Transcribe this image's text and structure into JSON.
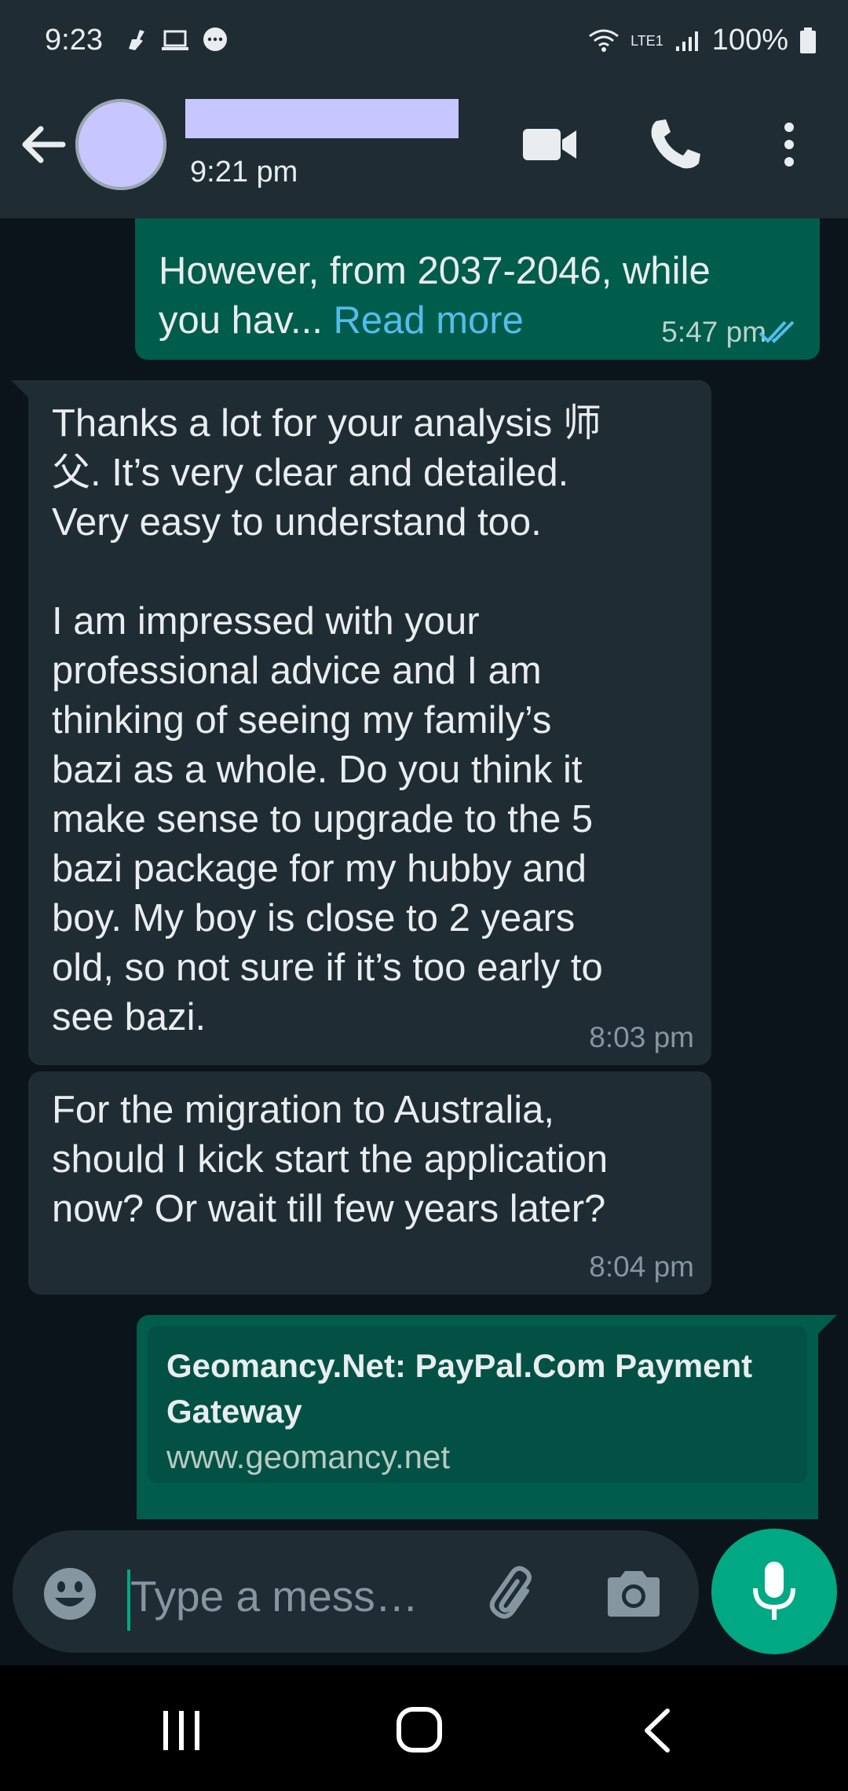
{
  "status_bar": {
    "time": "9:23",
    "battery": "100%",
    "network_label": "LTE1"
  },
  "header": {
    "last_seen": "9:21 pm"
  },
  "messages": [
    {
      "direction": "outgoing",
      "text": "However, from 2037-2046, while\nyou hav... ",
      "read_more": "Read more",
      "time": "5:47 pm",
      "status": "read"
    },
    {
      "direction": "incoming",
      "text": "Thanks a lot for your analysis 师\n父. It’s very clear and detailed.\nVery easy to understand too.\n\nI am impressed with your\nprofessional advice and I am\nthinking of seeing my family’s\nbazi as a whole. Do you think it\nmake sense to upgrade to the 5\nbazi package for my hubby and\nboy. My boy is close to 2 years\nold, so not sure if it’s too early to\nsee bazi.",
      "time": "8:03 pm"
    },
    {
      "direction": "incoming",
      "text": "For the migration to Australia,\nshould I kick start the application\nnow? Or wait till few years later?",
      "time": "8:04 pm"
    },
    {
      "direction": "outgoing",
      "link_title": "Geomancy.Net: PayPal.Com Payment\nGateway",
      "link_url": "www.geomancy.net"
    }
  ],
  "input": {
    "placeholder": "Type a mess…"
  },
  "colors": {
    "outgoing_bubble": "#005c4b",
    "incoming_bubble": "#1f2c34",
    "accent": "#00a884",
    "link": "#53bdeb"
  }
}
